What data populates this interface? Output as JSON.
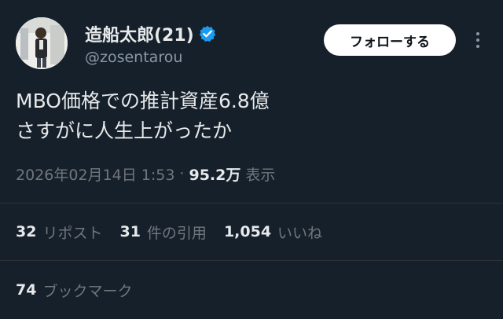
{
  "author": {
    "display_name": "造船太郎(21)",
    "handle": "@zosentarou",
    "verified_icon": "verified-badge-icon",
    "avatar_icon": "profile-photo"
  },
  "actions": {
    "follow_label": "フォローする",
    "more_icon": "more-options-icon"
  },
  "tweet": {
    "text_lines": [
      "MBO価格での推計資産6.8億",
      "さすがに人生上がったか"
    ]
  },
  "meta": {
    "timestamp": "2026年02月14日 1:53",
    "separator": "·",
    "views_count": "95.2万",
    "views_label": "表示"
  },
  "stats": {
    "reposts_count": "32",
    "reposts_label": "リポスト",
    "quotes_count": "31",
    "quotes_label": "件の引用",
    "likes_count": "1,054",
    "likes_label": "いいね"
  },
  "bookmarks": {
    "count": "74",
    "label": "ブックマーク"
  },
  "colors": {
    "background": "#15202b",
    "text_primary": "#e7e9ea",
    "text_secondary": "#71767b",
    "verified_blue": "#1d9bf0",
    "follow_button_bg": "#ffffff"
  }
}
